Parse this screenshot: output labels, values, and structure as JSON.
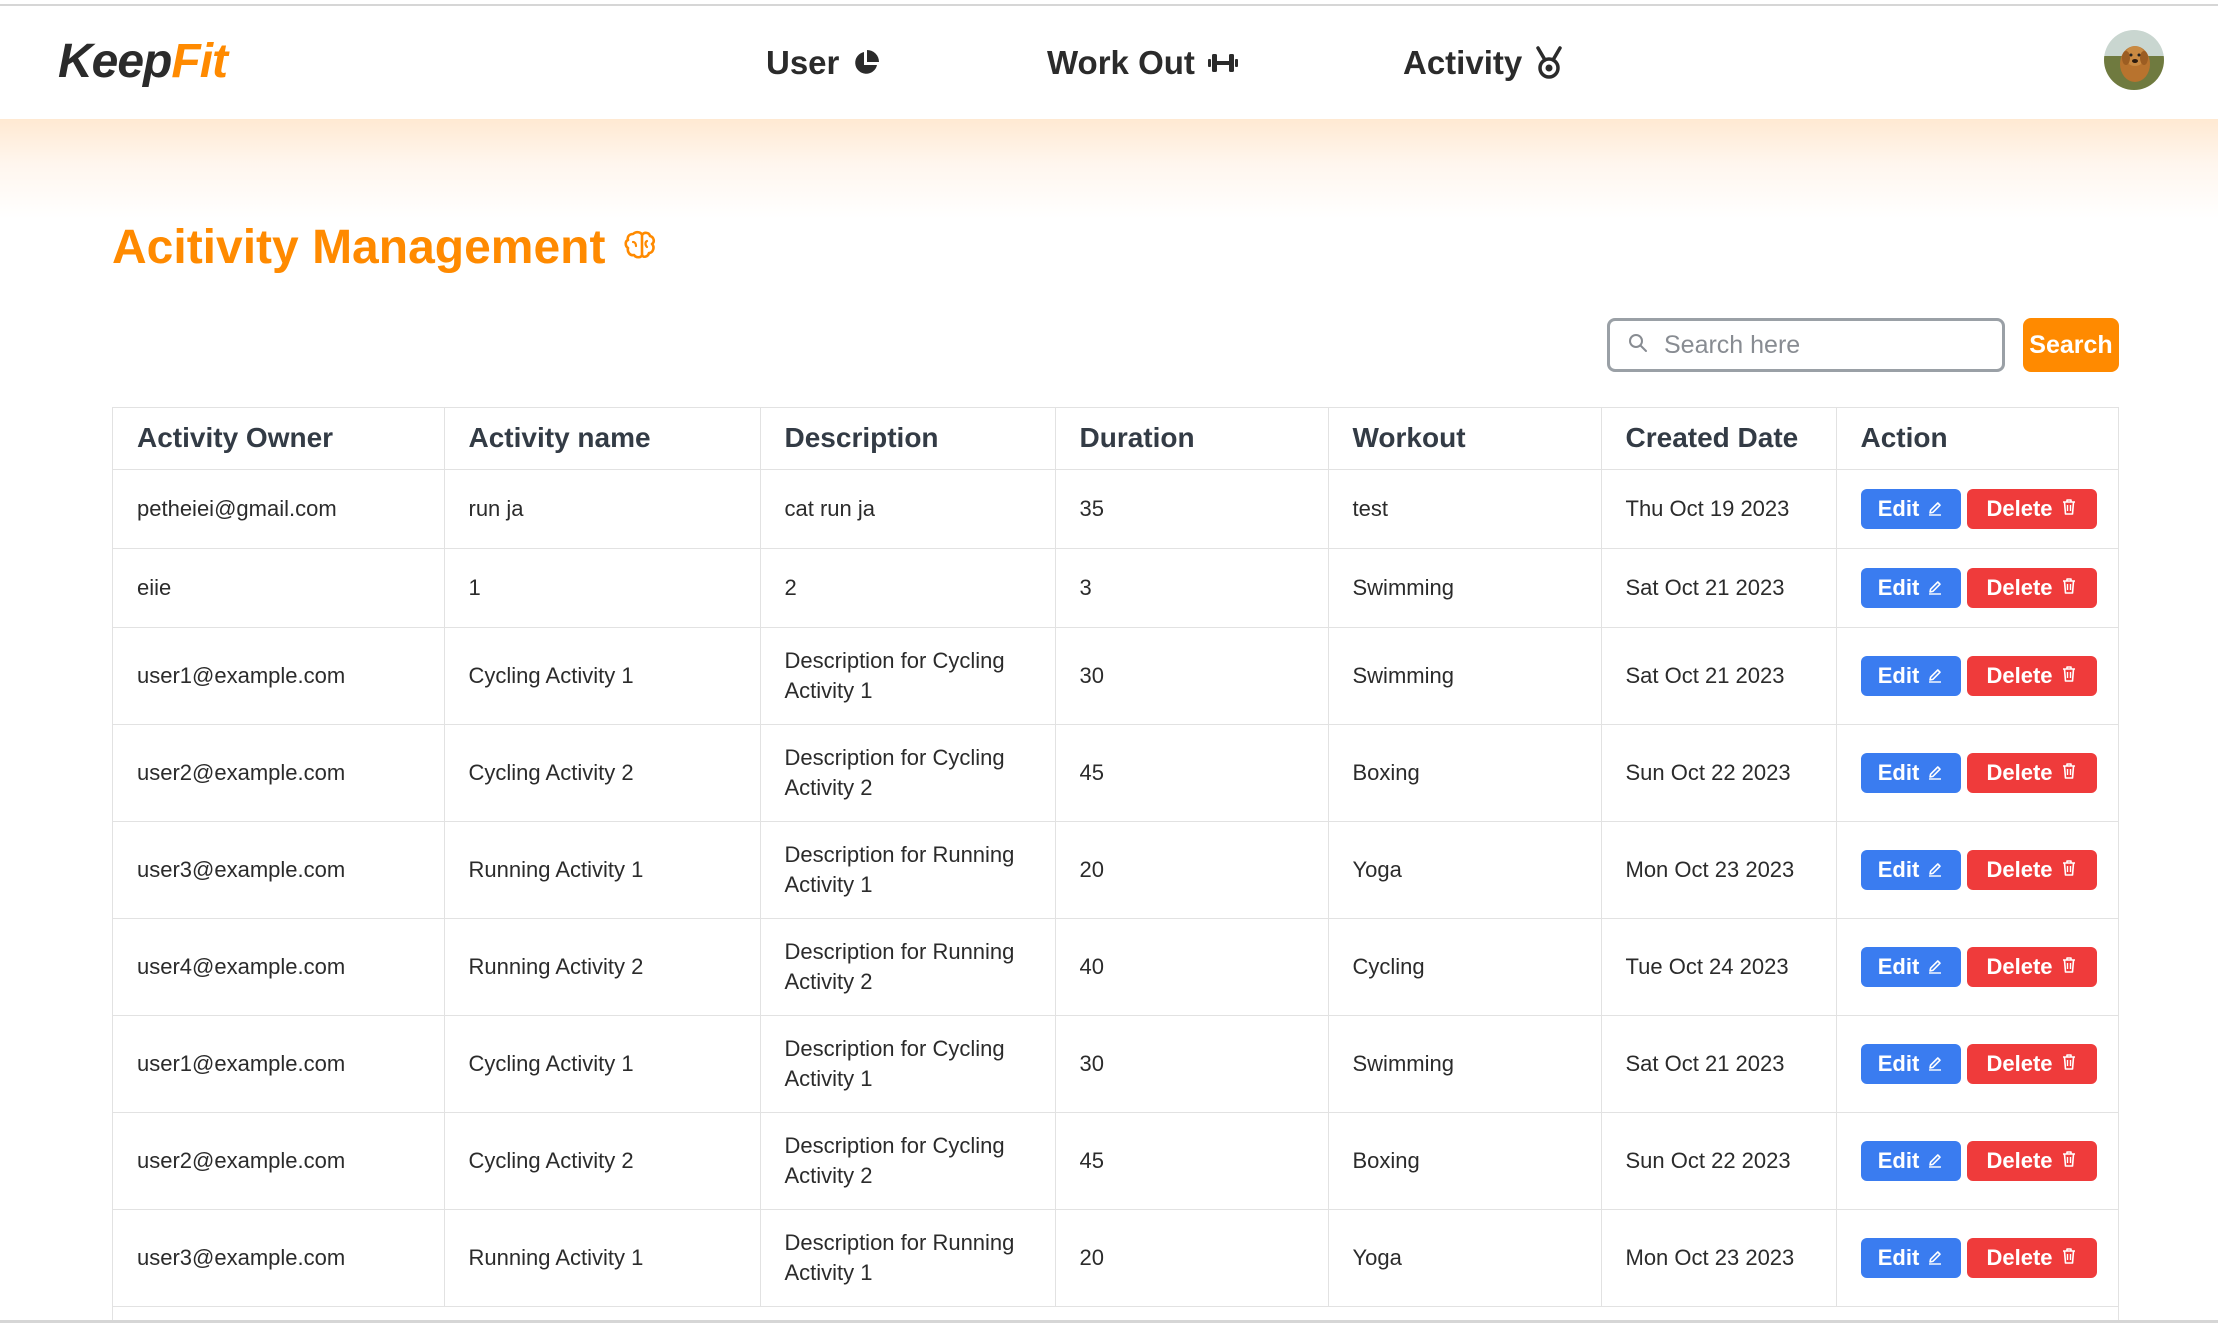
{
  "brand": {
    "part1": "Keep",
    "part2": "Fit",
    "accent": "#ff8a00",
    "dark": "#2b2b2b"
  },
  "nav": {
    "items": [
      {
        "label": "User",
        "icon": "pie-chart-icon"
      },
      {
        "label": "Work Out",
        "icon": "dumbbell-icon"
      },
      {
        "label": "Activity",
        "icon": "medal-icon"
      }
    ]
  },
  "page": {
    "title": "Acitivity Management",
    "title_icon": "brain-icon"
  },
  "search": {
    "placeholder": "Search here",
    "value": "",
    "button_label": "Search"
  },
  "table": {
    "columns": [
      "Activity Owner",
      "Activity name",
      "Description",
      "Duration",
      "Workout",
      "Created Date",
      "Action"
    ],
    "edit_label": "Edit",
    "delete_label": "Delete",
    "edit_color": "#3a7cf0",
    "delete_color": "#ef3b3b",
    "rows": [
      {
        "owner": "petheiei@gmail.com",
        "name": "run ja",
        "description": "cat run ja",
        "duration": "35",
        "workout": "test",
        "created": "Thu Oct 19 2023"
      },
      {
        "owner": "eiie",
        "name": "1",
        "description": "2",
        "duration": "3",
        "workout": "Swimming",
        "created": "Sat Oct 21 2023"
      },
      {
        "owner": "user1@example.com",
        "name": "Cycling Activity 1",
        "description": "Description for Cycling Activity 1",
        "duration": "30",
        "workout": "Swimming",
        "created": "Sat Oct 21 2023"
      },
      {
        "owner": "user2@example.com",
        "name": "Cycling Activity 2",
        "description": "Description for Cycling Activity 2",
        "duration": "45",
        "workout": "Boxing",
        "created": "Sun Oct 22 2023"
      },
      {
        "owner": "user3@example.com",
        "name": "Running Activity 1",
        "description": "Description for Running Activity 1",
        "duration": "20",
        "workout": "Yoga",
        "created": "Mon Oct 23 2023"
      },
      {
        "owner": "user4@example.com",
        "name": "Running Activity 2",
        "description": "Description for Running Activity 2",
        "duration": "40",
        "workout": "Cycling",
        "created": "Tue Oct 24 2023"
      },
      {
        "owner": "user1@example.com",
        "name": "Cycling Activity 1",
        "description": "Description for Cycling Activity 1",
        "duration": "30",
        "workout": "Swimming",
        "created": "Sat Oct 21 2023"
      },
      {
        "owner": "user2@example.com",
        "name": "Cycling Activity 2",
        "description": "Description for Cycling Activity 2",
        "duration": "45",
        "workout": "Boxing",
        "created": "Sun Oct 22 2023"
      },
      {
        "owner": "user3@example.com",
        "name": "Running Activity 1",
        "description": "Description for Running Activity 1",
        "duration": "20",
        "workout": "Yoga",
        "created": "Mon Oct 23 2023"
      }
    ]
  }
}
